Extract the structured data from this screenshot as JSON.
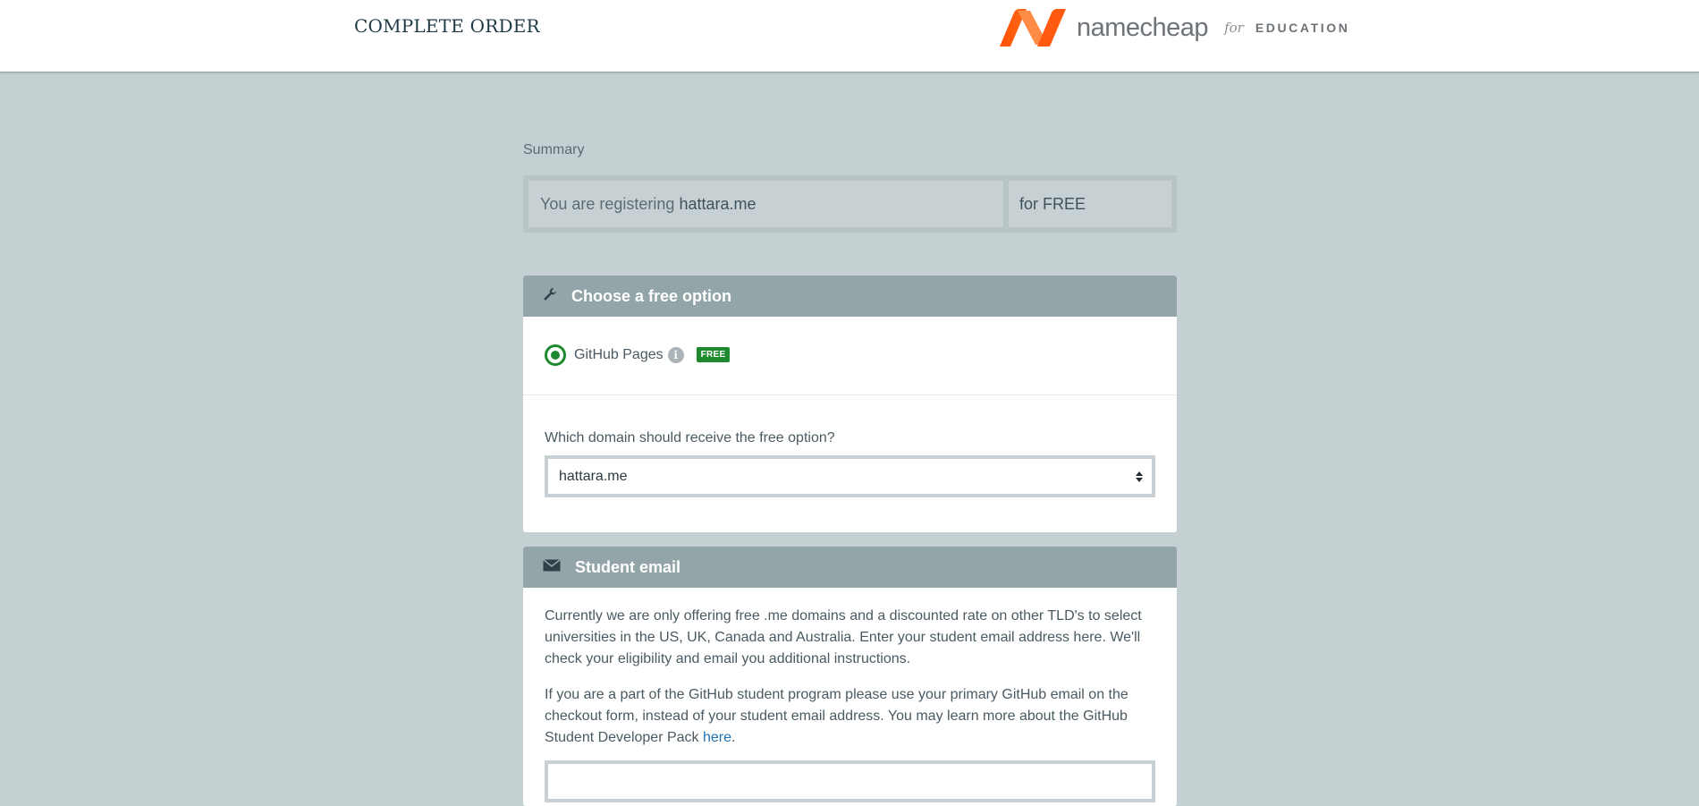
{
  "header": {
    "title": "COMPLETE ORDER",
    "logo": {
      "wordmark": "namecheap",
      "for": "for",
      "edu": "EDUCATION",
      "icon": "namecheap-n-logo",
      "colors": [
        "#ff5000",
        "#ff8c44"
      ]
    }
  },
  "summary": {
    "label": "Summary",
    "registering_text": "You are registering",
    "domain": "hattara.me",
    "price": "for FREE"
  },
  "free_option": {
    "title": "Choose a free option",
    "icon": "wrench-icon",
    "option_label": "GitHub Pages",
    "info_icon": "info-icon",
    "info_glyph": "i",
    "badge": "FREE",
    "domain_question": "Which domain should receive the free option?",
    "selected_domain": "hattara.me",
    "accent": "#1e8a2f"
  },
  "student_email": {
    "title": "Student email",
    "icon": "envelope-icon",
    "para1": "Currently we are only offering free .me domains and a discounted rate on other TLD's to select universities in the US, UK, Canada and Australia. Enter your student email address here. We'll check your eligibility and email you additional instructions.",
    "para2_text": "If you are a part of the GitHub student program please use your primary GitHub email on the checkout form, instead of your student email address. You may learn more about the GitHub Student Developer Pack",
    "para2_link": "here",
    "para2_end": "."
  }
}
